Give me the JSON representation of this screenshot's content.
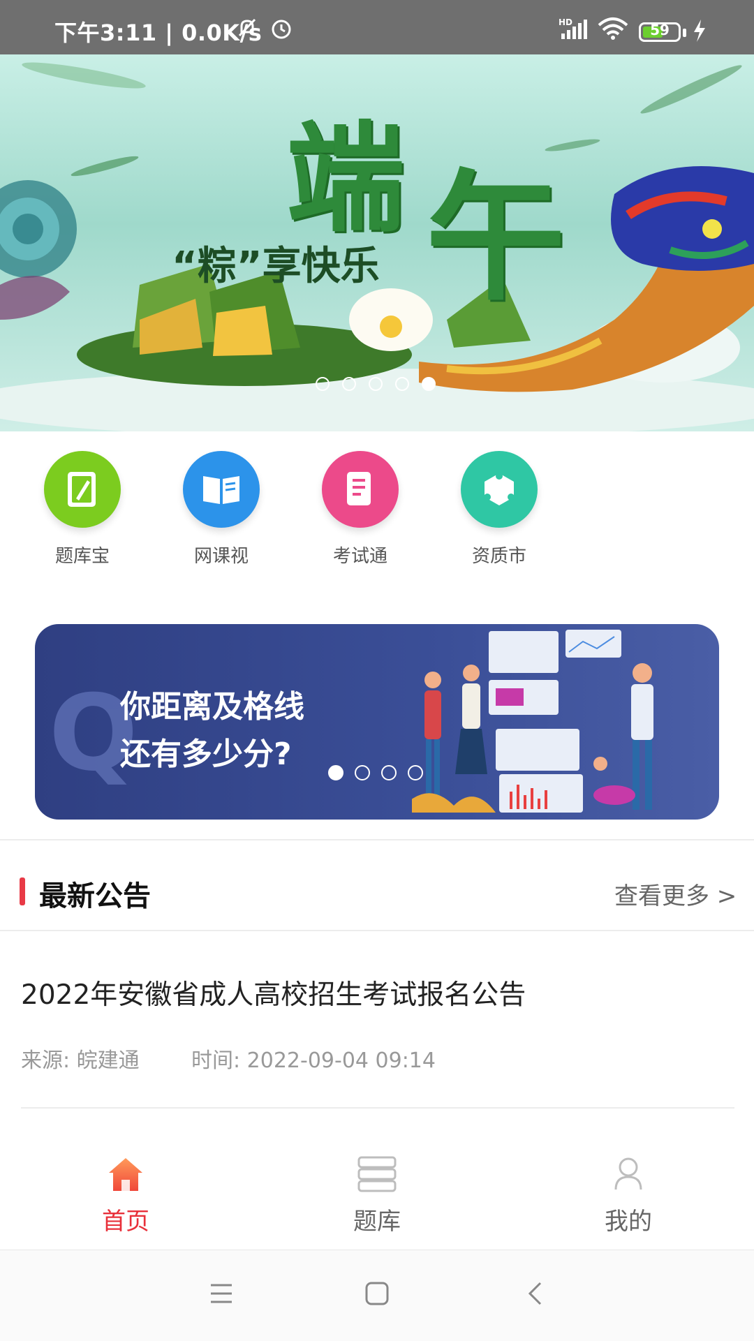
{
  "status_bar": {
    "time": "下午3:11",
    "network_speed": "0.0K/s",
    "battery": "59",
    "battery_level": 0.59,
    "icons": [
      "mute-bell-icon",
      "alarm-icon",
      "hd-signal-icon",
      "wifi-icon",
      "battery-icon",
      "charging-icon"
    ]
  },
  "banner": {
    "festival_chars": [
      "端",
      "午"
    ],
    "subtitle": "“粽”享快乐",
    "slide_count": 5,
    "active_slide": 5
  },
  "quick_entries": [
    {
      "label": "题库宝",
      "icon": "notebook-pencil-icon",
      "color": "#7ccc1f"
    },
    {
      "label": "网课视",
      "icon": "open-book-icon",
      "color": "#2c93ea"
    },
    {
      "label": "考试通",
      "icon": "document-icon",
      "color": "#ec4a8a"
    },
    {
      "label": "资质市",
      "icon": "hexagon-network-icon",
      "color": "#2fc7a4"
    }
  ],
  "promo": {
    "line1": "你距离及格线",
    "line2": "还有多少分?",
    "slide_count": 4,
    "active_slide": 1
  },
  "announcements": {
    "section_title": "最新公告",
    "more_label": "查看更多 >",
    "items": [
      {
        "title": "2022年安徽省成人高校招生考试报名公告",
        "source": "来源: 皖建通",
        "time": "时间: 2022-09-04 09:14"
      }
    ]
  },
  "tab_bar": {
    "tabs": [
      {
        "label": "首页",
        "icon": "home-icon",
        "active": true
      },
      {
        "label": "题库",
        "icon": "stack-icon",
        "active": false
      },
      {
        "label": "我的",
        "icon": "user-icon",
        "active": false
      }
    ],
    "active_color": "#e8303a",
    "inactive_color": "#666666"
  },
  "nav_bar": {
    "icons": [
      "menu-icon",
      "home-square-icon",
      "back-icon"
    ]
  }
}
